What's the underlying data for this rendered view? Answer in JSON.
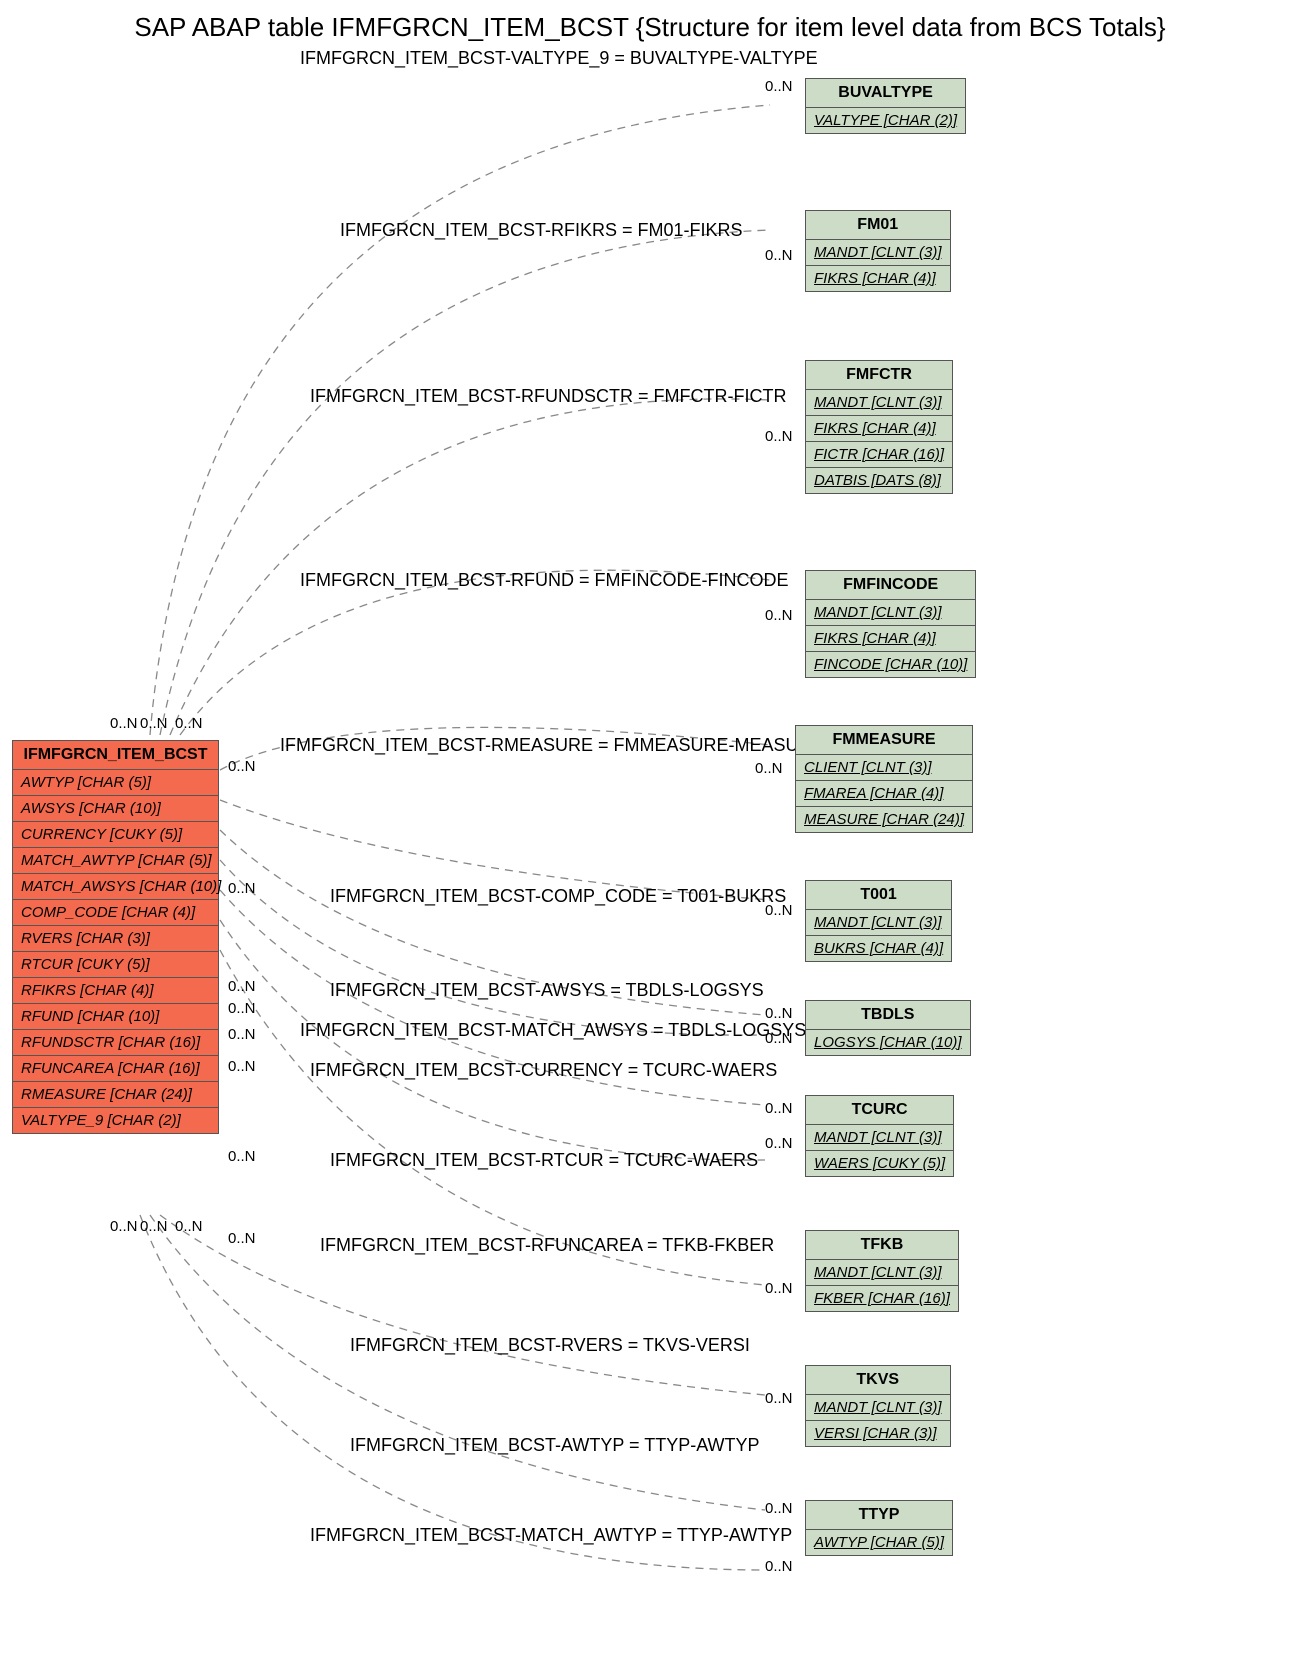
{
  "title": "SAP ABAP table IFMFGRCN_ITEM_BCST {Structure for item level data from BCS Totals}",
  "main": {
    "name": "IFMFGRCN_ITEM_BCST",
    "fields": [
      "AWTYP [CHAR (5)]",
      "AWSYS [CHAR (10)]",
      "CURRENCY [CUKY (5)]",
      "MATCH_AWTYP [CHAR (5)]",
      "MATCH_AWSYS [CHAR (10)]",
      "COMP_CODE [CHAR (4)]",
      "RVERS [CHAR (3)]",
      "RTCUR [CUKY (5)]",
      "RFIKRS [CHAR (4)]",
      "RFUND [CHAR (10)]",
      "RFUNDSCTR [CHAR (16)]",
      "RFUNCAREA [CHAR (16)]",
      "RMEASURE [CHAR (24)]",
      "VALTYPE_9 [CHAR (2)]"
    ]
  },
  "refs": [
    {
      "name": "BUVALTYPE",
      "fields": [
        {
          "t": "VALTYPE [CHAR (2)]",
          "u": 1
        }
      ]
    },
    {
      "name": "FM01",
      "fields": [
        {
          "t": "MANDT [CLNT (3)]",
          "u": 1
        },
        {
          "t": "FIKRS [CHAR (4)]",
          "u": 1
        }
      ]
    },
    {
      "name": "FMFCTR",
      "fields": [
        {
          "t": "MANDT [CLNT (3)]",
          "u": 1
        },
        {
          "t": "FIKRS [CHAR (4)]",
          "u": 1
        },
        {
          "t": "FICTR [CHAR (16)]",
          "u": 1
        },
        {
          "t": "DATBIS [DATS (8)]",
          "u": 1
        }
      ]
    },
    {
      "name": "FMFINCODE",
      "fields": [
        {
          "t": "MANDT [CLNT (3)]",
          "u": 1
        },
        {
          "t": "FIKRS [CHAR (4)]",
          "u": 1
        },
        {
          "t": "FINCODE [CHAR (10)]",
          "u": 1
        }
      ]
    },
    {
      "name": "FMMEASURE",
      "fields": [
        {
          "t": "CLIENT [CLNT (3)]",
          "u": 1
        },
        {
          "t": "FMAREA [CHAR (4)]",
          "u": 1
        },
        {
          "t": "MEASURE [CHAR (24)]",
          "u": 1
        }
      ]
    },
    {
      "name": "T001",
      "fields": [
        {
          "t": "MANDT [CLNT (3)]",
          "u": 1
        },
        {
          "t": "BUKRS [CHAR (4)]",
          "u": 1
        }
      ]
    },
    {
      "name": "TBDLS",
      "fields": [
        {
          "t": "LOGSYS [CHAR (10)]",
          "u": 1
        }
      ]
    },
    {
      "name": "TCURC",
      "fields": [
        {
          "t": "MANDT [CLNT (3)]",
          "u": 1
        },
        {
          "t": "WAERS [CUKY (5)]",
          "u": 1
        }
      ]
    },
    {
      "name": "TFKB",
      "fields": [
        {
          "t": "MANDT [CLNT (3)]",
          "u": 1
        },
        {
          "t": "FKBER [CHAR (16)]",
          "u": 1
        }
      ]
    },
    {
      "name": "TKVS",
      "fields": [
        {
          "t": "MANDT [CLNT (3)]",
          "u": 1
        },
        {
          "t": "VERSI [CHAR (3)]",
          "u": 1
        }
      ]
    },
    {
      "name": "TTYP",
      "fields": [
        {
          "t": "AWTYP [CHAR (5)]",
          "u": 1
        }
      ]
    }
  ],
  "relLabels": [
    "IFMFGRCN_ITEM_BCST-VALTYPE_9 = BUVALTYPE-VALTYPE",
    "IFMFGRCN_ITEM_BCST-RFIKRS = FM01-FIKRS",
    "IFMFGRCN_ITEM_BCST-RFUNDSCTR = FMFCTR-FICTR",
    "IFMFGRCN_ITEM_BCST-RFUND = FMFINCODE-FINCODE",
    "IFMFGRCN_ITEM_BCST-RMEASURE = FMMEASURE-MEASURE",
    "IFMFGRCN_ITEM_BCST-COMP_CODE = T001-BUKRS",
    "IFMFGRCN_ITEM_BCST-AWSYS = TBDLS-LOGSYS",
    "IFMFGRCN_ITEM_BCST-MATCH_AWSYS = TBDLS-LOGSYS",
    "IFMFGRCN_ITEM_BCST-CURRENCY = TCURC-WAERS",
    "IFMFGRCN_ITEM_BCST-RTCUR = TCURC-WAERS",
    "IFMFGRCN_ITEM_BCST-RFUNCAREA = TFKB-FKBER",
    "IFMFGRCN_ITEM_BCST-RVERS = TKVS-VERSI",
    "IFMFGRCN_ITEM_BCST-AWTYP = TTYP-AWTYP",
    "IFMFGRCN_ITEM_BCST-MATCH_AWTYP = TTYP-AWTYP"
  ],
  "card": "0..N"
}
